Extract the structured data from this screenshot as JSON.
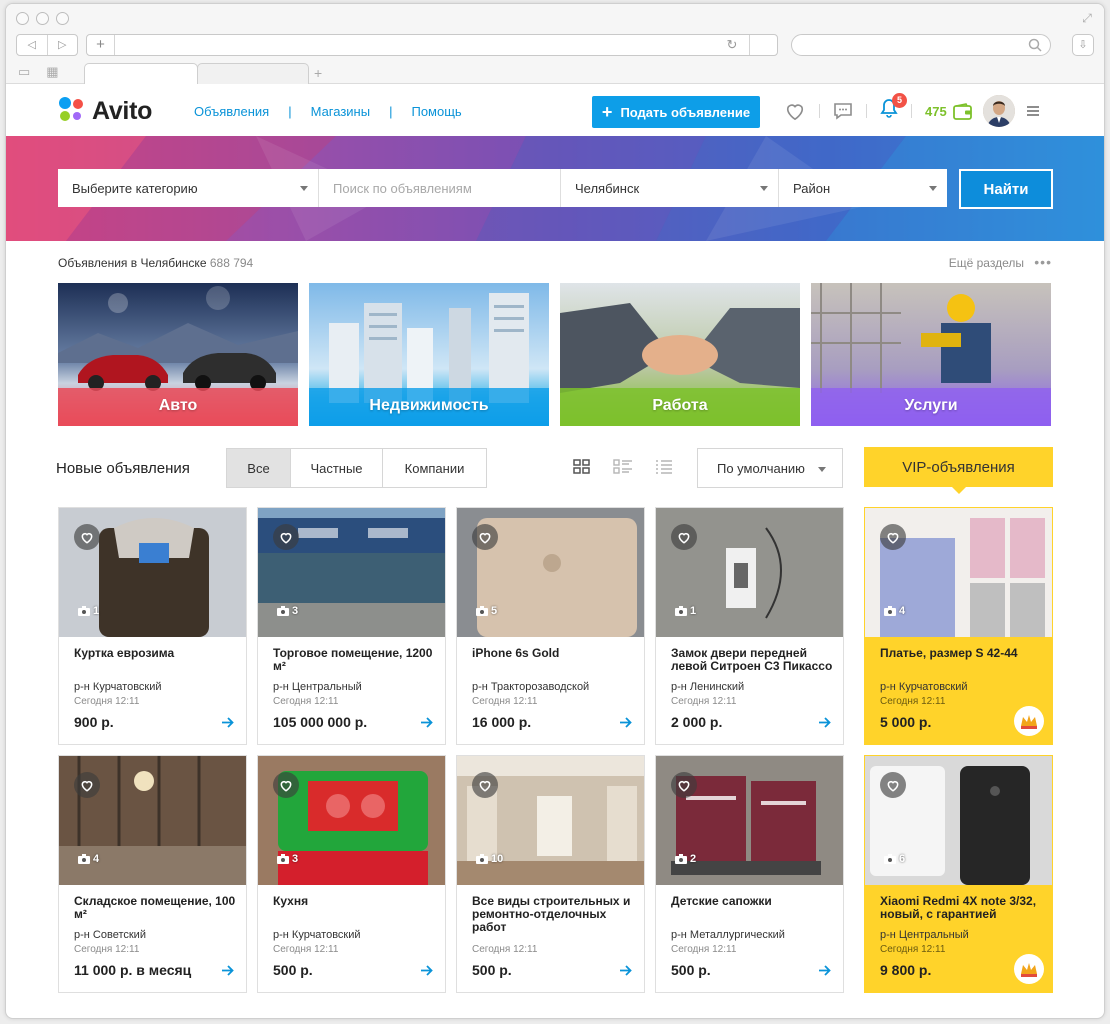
{
  "header": {
    "logo": "Avito",
    "nav": [
      "Объявления",
      "Магазины",
      "Помощь"
    ],
    "post_button": "Подать объявление",
    "notification_count": "5",
    "balance": "475"
  },
  "search": {
    "category": "Выберите категорию",
    "query_placeholder": "Поиск по объявлениям",
    "city": "Челябинск",
    "district": "Район",
    "submit": "Найти"
  },
  "summary": {
    "label": "Объявления в Челябинске",
    "count": "688 794",
    "more_sections": "Ещё разделы"
  },
  "categories": [
    "Авто",
    "Недвижимость",
    "Работа",
    "Услуги"
  ],
  "listing": {
    "title": "Новые объявления",
    "filters": [
      "Все",
      "Частные",
      "Компании"
    ],
    "sort": "По умолчанию",
    "vip_title": "VIP-объявления"
  },
  "ads": [
    {
      "title": "Куртка еврозима",
      "location": "р-н Курчатовский",
      "time": "Сегодня 12:11",
      "price": "900 р.",
      "photos": "1"
    },
    {
      "title": "Торговое помещение, 1200 м²",
      "location": "р-н Центральный",
      "time": "Сегодня 12:11",
      "price": "105 000 000 р.",
      "photos": "3"
    },
    {
      "title": "iPhone 6s Gold",
      "location": "р-н Тракторозаводской",
      "time": "Сегодня 12:11",
      "price": "16 000 р.",
      "photos": "5"
    },
    {
      "title": "Замок двери передней левой Ситроен С3 Пикассо",
      "location": "р-н Ленинский",
      "time": "Сегодня 12:11",
      "price": "2 000 р.",
      "photos": "1"
    },
    {
      "title": "Платье, размер S 42-44",
      "location": "р-н Курчатовский",
      "time": "Сегодня 12:11",
      "price": "5 000 р.",
      "photos": "4"
    },
    {
      "title": "Складское помещение, 100 м²",
      "location": "р-н Советский",
      "time": "Сегодня 12:11",
      "price": "11 000 р. в месяц",
      "photos": "4"
    },
    {
      "title": "Кухня",
      "location": "р-н Курчатовский",
      "time": "Сегодня 12:11",
      "price": "500 р.",
      "photos": "3"
    },
    {
      "title": "Все виды строительных и ремонтно-отделочных работ",
      "location": "",
      "time": "Сегодня 12:11",
      "price": "500 р.",
      "photos": "10"
    },
    {
      "title": "Детские сапожки",
      "location": "р-н Металлургический",
      "time": "Сегодня 12:11",
      "price": "500 р.",
      "photos": "2"
    },
    {
      "title": "Xiaomi Redmi 4X note 3/32, новый, с гарантией",
      "location": "р-н Центральный",
      "time": "Сегодня 12:11",
      "price": "9 800 р.",
      "photos": "6"
    }
  ],
  "colors": {
    "accent": "#0d9ee8",
    "link": "#0a93d8",
    "vip": "#ffd32a",
    "balance": "#7dc12b",
    "badge": "#f25246"
  }
}
